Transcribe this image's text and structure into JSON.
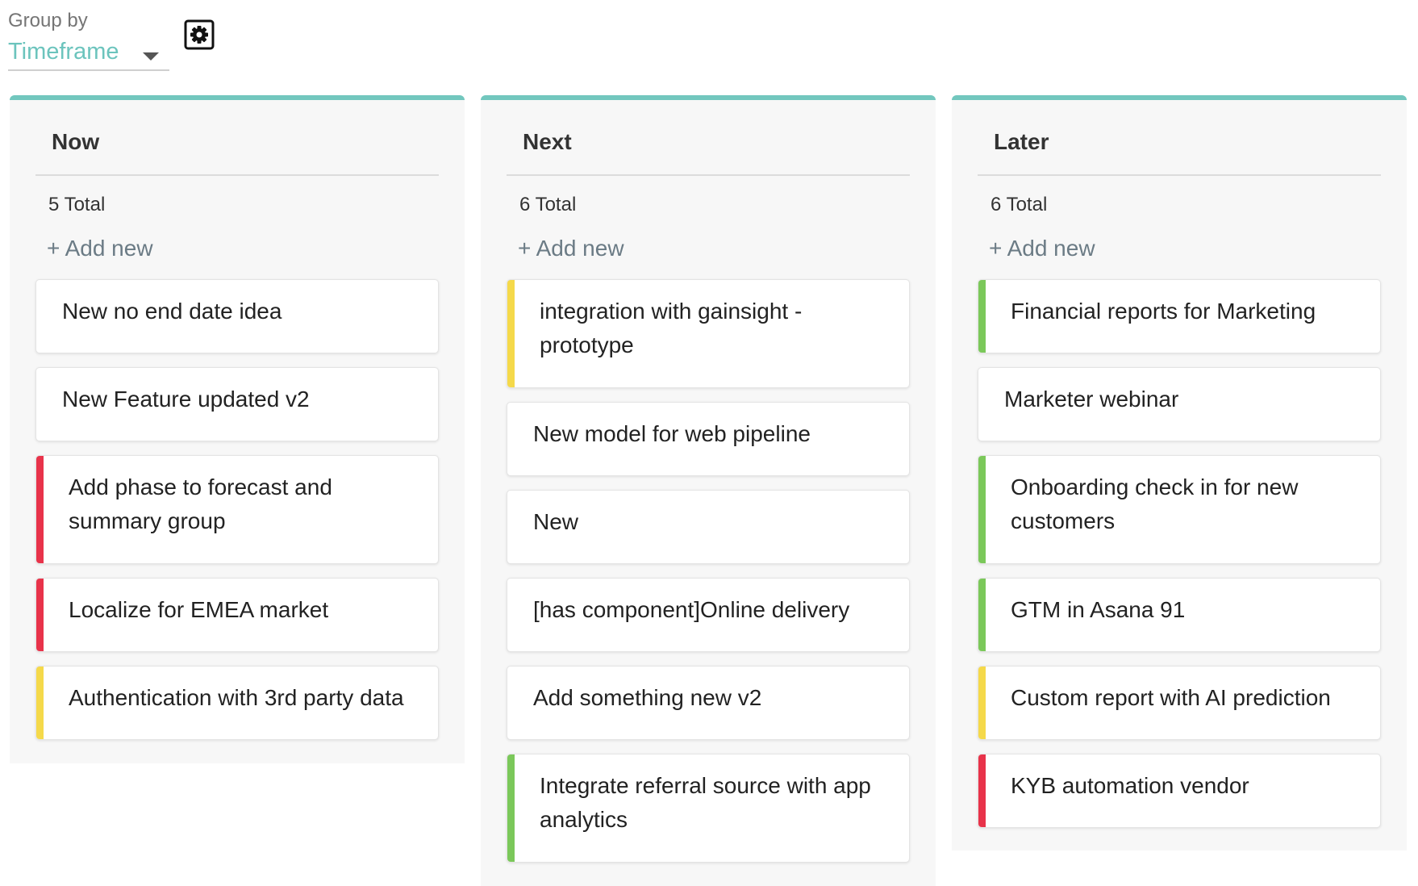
{
  "toolbar": {
    "group_by_label": "Group by",
    "group_by_value": "Timeframe",
    "settings_icon": "gear-icon",
    "accent_color": "#72c7be"
  },
  "columns": [
    {
      "title": "Now",
      "total": "5 Total",
      "add_new": "+ Add new",
      "cards": [
        {
          "text": "New no end date idea",
          "status": "none"
        },
        {
          "text": "New Feature updated v2",
          "status": "none"
        },
        {
          "text": "Add phase to forecast and summary group",
          "status": "red"
        },
        {
          "text": "Localize for EMEA market",
          "status": "red"
        },
        {
          "text": "Authentication with 3rd party data",
          "status": "yellow"
        }
      ]
    },
    {
      "title": "Next",
      "total": "6 Total",
      "add_new": "+ Add new",
      "cards": [
        {
          "text": "integration with gainsight - prototype",
          "status": "yellow"
        },
        {
          "text": "New model for web pipeline",
          "status": "none"
        },
        {
          "text": "New",
          "status": "none"
        },
        {
          "text": "[has component]Online delivery",
          "status": "none"
        },
        {
          "text": "Add something new v2",
          "status": "none"
        },
        {
          "text": "Integrate referral source with app analytics",
          "status": "green"
        }
      ]
    },
    {
      "title": "Later",
      "total": "6 Total",
      "add_new": "+ Add new",
      "cards": [
        {
          "text": "Financial reports for Marketing",
          "status": "green"
        },
        {
          "text": "Marketer webinar",
          "status": "none"
        },
        {
          "text": "Onboarding check in for new customers",
          "status": "green"
        },
        {
          "text": "GTM in Asana 91",
          "status": "green"
        },
        {
          "text": "Custom report with AI prediction",
          "status": "yellow"
        },
        {
          "text": "KYB automation vendor",
          "status": "red"
        }
      ]
    }
  ],
  "status_colors": {
    "red": "#e8334a",
    "yellow": "#f5d94a",
    "green": "#7bc85a"
  }
}
